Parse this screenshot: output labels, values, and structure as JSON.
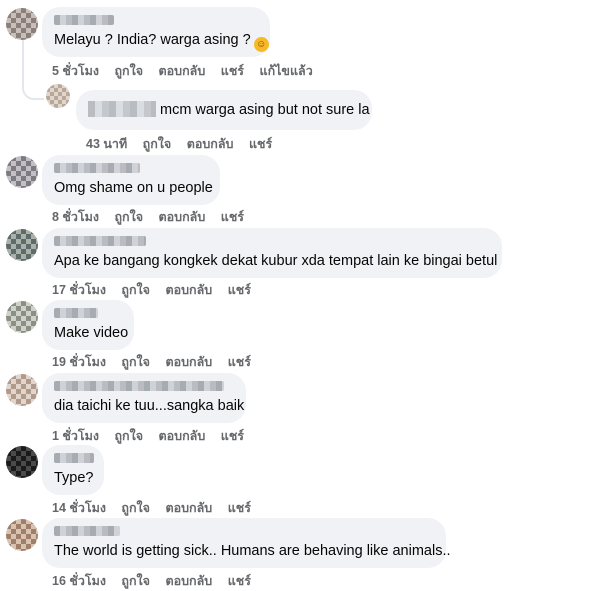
{
  "comments": [
    {
      "text": "Melayu ? India? warga asing ?",
      "emoji": "rolling-on-floor-laughing-emoji",
      "time": "5 ชั่วโมง",
      "like": "ถูกใจ",
      "reply": "ตอบกลับ",
      "share": "แชร์",
      "edited": "แก้ไขแล้ว",
      "avatar_color": "#8a7f7a"
    },
    {
      "text": "mcm warga asing but not sure la",
      "time": "43 นาที",
      "like": "ถูกใจ",
      "reply": "ตอบกลับ",
      "share": "แชร์",
      "avatar_color": "#b8a89a"
    },
    {
      "text": "Omg shame on u people",
      "time": "8 ชั่วโมง",
      "like": "ถูกใจ",
      "reply": "ตอบกลับ",
      "share": "แชร์",
      "avatar_color": "#7d7b80"
    },
    {
      "text": "Apa ke bangang kongkek dekat kubur xda tempat lain ke bingai betul",
      "time": "17 ชั่วโมง",
      "like": "ถูกใจ",
      "reply": "ตอบกลับ",
      "share": "แชร์",
      "avatar_color": "#5f6b6a"
    },
    {
      "text": "Make video",
      "time": "19 ชั่วโมง",
      "like": "ถูกใจ",
      "reply": "ตอบกลับ",
      "share": "แชร์",
      "avatar_color": "#8c8f86"
    },
    {
      "text": "dia taichi ke tuu...sangka baik",
      "time": "1 ชั่วโมง",
      "like": "ถูกใจ",
      "reply": "ตอบกลับ",
      "share": "แชร์",
      "avatar_color": "#b09a8c"
    },
    {
      "text": "Type?",
      "time": "14 ชั่วโมง",
      "like": "ถูกใจ",
      "reply": "ตอบกลับ",
      "share": "แชร์",
      "avatar_color": "#2a2a2a"
    },
    {
      "text": "The world is getting sick.. Humans are behaving like animals..",
      "time": "16 ชั่วโมง",
      "like": "ถูกใจ",
      "reply": "ตอบกลับ",
      "share": "แชร์",
      "avatar_color": "#a07f6a"
    }
  ]
}
